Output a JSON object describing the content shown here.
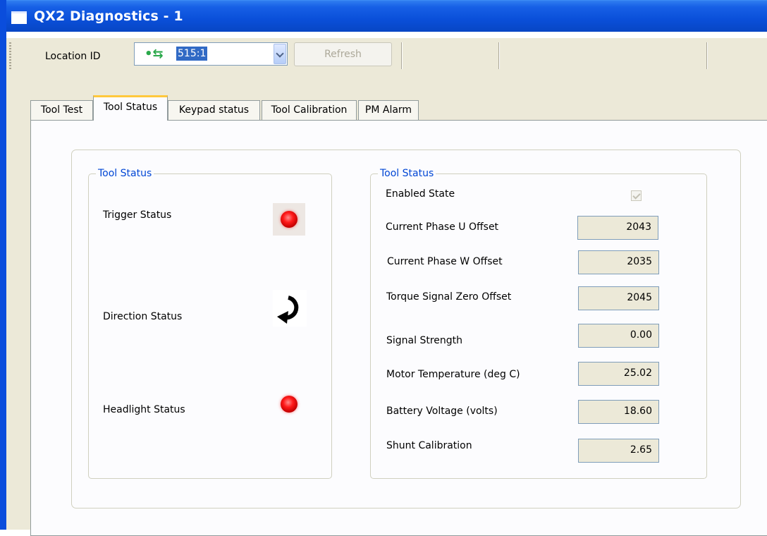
{
  "window": {
    "title": "QX2 Diagnostics - 1"
  },
  "toolbar": {
    "location_label": "Location ID",
    "location_value": "515:1",
    "refresh_label": "Refresh"
  },
  "tabs": [
    {
      "label": "Tool Test"
    },
    {
      "label": "Tool Status",
      "active": true
    },
    {
      "label": "Keypad status"
    },
    {
      "label": "Tool Calibration"
    },
    {
      "label": "PM Alarm"
    }
  ],
  "left_group": {
    "title": "Tool Status",
    "trigger_label": "Trigger Status",
    "trigger_icon": "red-led-icon",
    "direction_label": "Direction Status",
    "direction_icon": "counterclockwise-arrow-icon",
    "headlight_label": "Headlight Status",
    "headlight_icon": "red-led-icon"
  },
  "right_group": {
    "title": "Tool Status",
    "enabled_label": "Enabled State",
    "enabled_checked": true,
    "rows": [
      {
        "label": "Current Phase U Offset",
        "value": "2043"
      },
      {
        "label": "Current Phase W Offset",
        "value": "2035"
      },
      {
        "label": "Torque Signal Zero Offset",
        "value": "2045"
      },
      {
        "label": "Signal Strength",
        "value": "0.00"
      },
      {
        "label": "Motor Temperature (deg C)",
        "value": "25.02"
      },
      {
        "label": "Battery Voltage (volts)",
        "value": "18.60"
      },
      {
        "label": "Shunt Calibration",
        "value": "2.65"
      }
    ]
  },
  "colors": {
    "titlebar": "#0a4fd9",
    "group_title": "#0046d5",
    "led": "#ff1a1a",
    "active_tab_accent": "#ffc83c"
  }
}
